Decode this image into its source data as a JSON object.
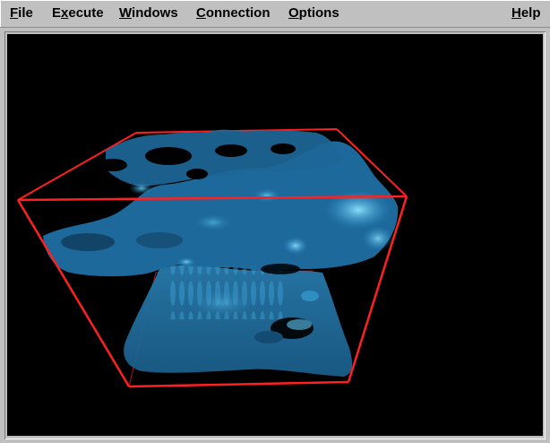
{
  "menubar": {
    "items": [
      {
        "id": "file",
        "pre": "",
        "accel": "F",
        "post": "ile"
      },
      {
        "id": "execute",
        "pre": "E",
        "accel": "x",
        "post": "ecute"
      },
      {
        "id": "windows",
        "pre": "",
        "accel": "W",
        "post": "indows"
      },
      {
        "id": "connection",
        "pre": "",
        "accel": "C",
        "post": "onnection"
      },
      {
        "id": "options",
        "pre": "",
        "accel": "O",
        "post": "ptions"
      },
      {
        "id": "help",
        "pre": "",
        "accel": "H",
        "post": "elp"
      }
    ]
  },
  "viewport": {
    "background": "#000000",
    "bounding_box_color": "#ff2020",
    "surface_color": "#1e6a9a",
    "highlight_color": "#6fd0ff"
  }
}
